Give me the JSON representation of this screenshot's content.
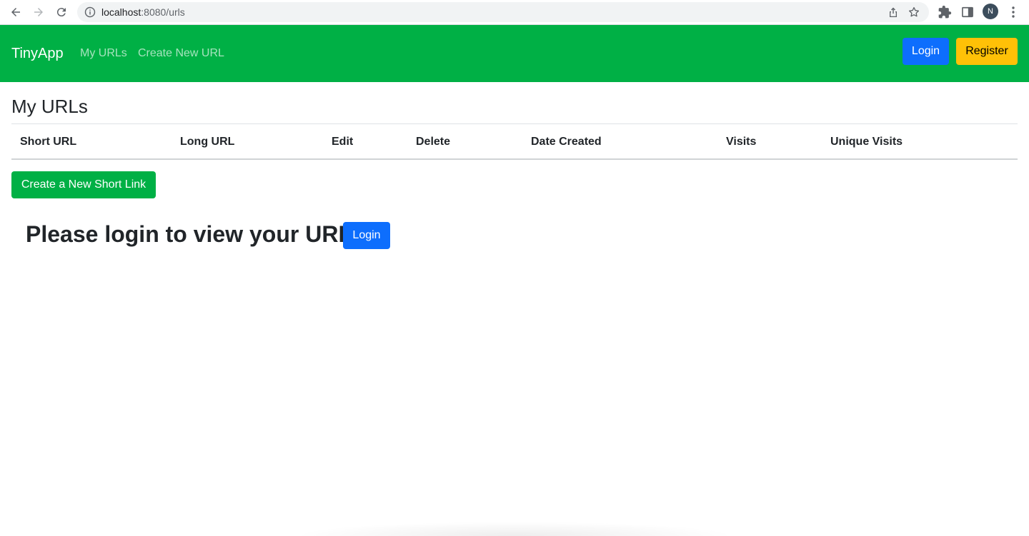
{
  "browser": {
    "url_host": "localhost",
    "url_rest": ":8080/urls",
    "profile_initial": "N",
    "icons": [
      "back-icon",
      "forward-icon",
      "reload-icon",
      "info-icon",
      "share-icon",
      "star-icon",
      "extensions-icon",
      "side-panel-icon",
      "menu-icon"
    ]
  },
  "navbar": {
    "brand": "TinyApp",
    "links": [
      "My URLs",
      "Create New URL"
    ],
    "login_label": "Login",
    "register_label": "Register",
    "colors": {
      "background": "#00b045",
      "login": "#0d6efd",
      "register": "#ffc107"
    }
  },
  "main": {
    "title": "My URLs",
    "table_headers": [
      "Short URL",
      "Long URL",
      "Edit",
      "Delete",
      "Date Created",
      "Visits",
      "Unique Visits"
    ],
    "create_button_label": "Create a New Short Link",
    "prompt_text": "Please login to view your URLs:",
    "prompt_login_label": "Login"
  }
}
